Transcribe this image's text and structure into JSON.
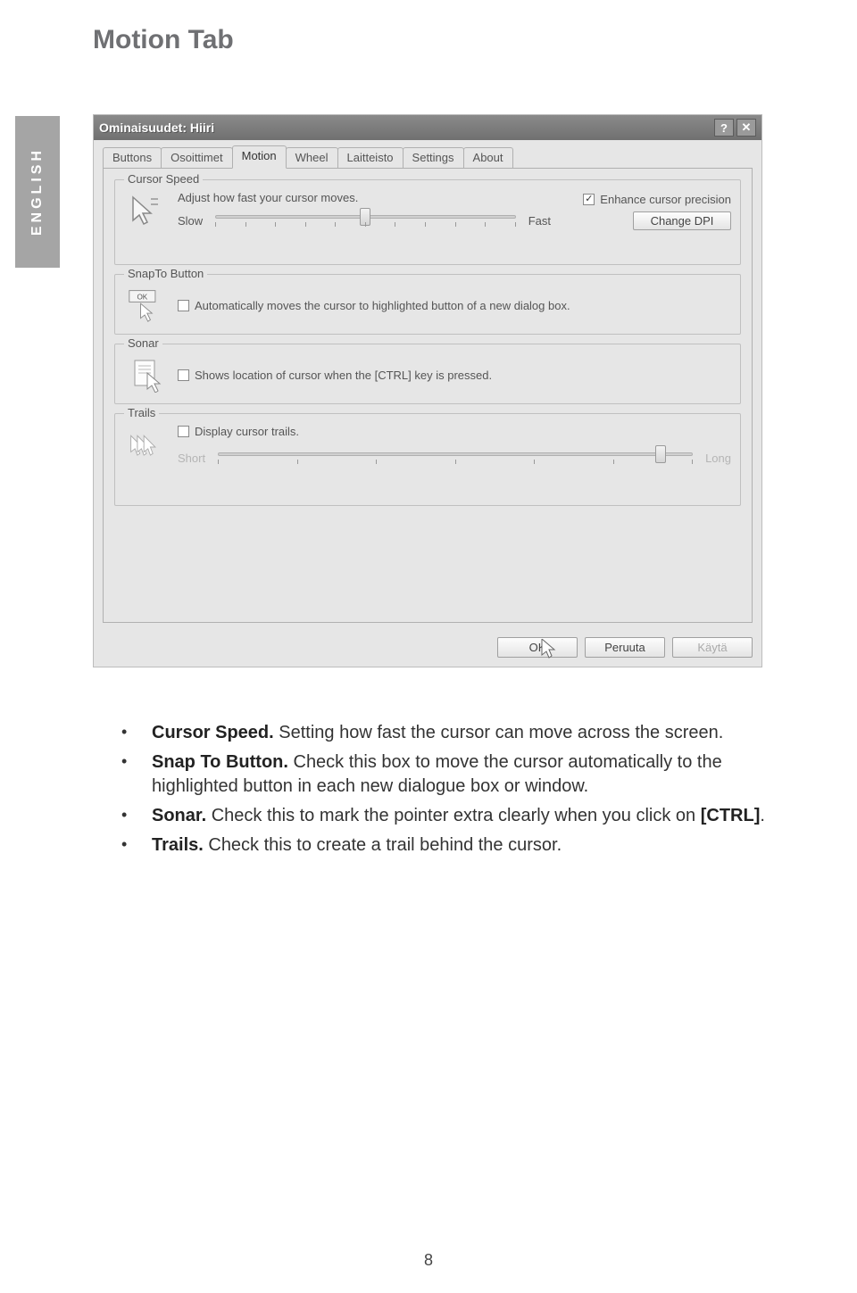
{
  "side_tab": "ENGLISH",
  "page_title": "Motion Tab",
  "dialog": {
    "title": "Ominaisuudet: Hiiri",
    "tabs": [
      "Buttons",
      "Osoittimet",
      "Motion",
      "Wheel",
      "Laitteisto",
      "Settings",
      "About"
    ],
    "active_tab_index": 2,
    "cursor_speed": {
      "group": "Cursor Speed",
      "desc": "Adjust how fast your cursor moves.",
      "slow": "Slow",
      "fast": "Fast",
      "enhance_label": "Enhance cursor precision",
      "enhance_checked": true,
      "change_dpi": "Change DPI",
      "slider_pos_pct": 48
    },
    "snapto": {
      "group": "SnapTo Button",
      "checked": false,
      "label": "Automatically moves the cursor to highlighted button of a new dialog box.",
      "icon_text": "OK"
    },
    "sonar": {
      "group": "Sonar",
      "checked": false,
      "label": "Shows location of cursor when the [CTRL] key is pressed."
    },
    "trails": {
      "group": "Trails",
      "checked": false,
      "label": "Display cursor trails.",
      "short": "Short",
      "long": "Long",
      "slider_pos_pct": 92
    },
    "footer": {
      "ok": "OK",
      "cancel": "Peruuta",
      "apply": "Käytä"
    }
  },
  "bullets": {
    "b1_bold": "Cursor Speed.",
    "b1_rest": " Setting how fast the cursor can move across the screen.",
    "b2_bold": "Snap To Button.",
    "b2_rest": " Check this box to move the cursor automatically to the highlighted button in each new dialogue box or window.",
    "b3_bold": "Sonar.",
    "b3_rest": " Check this to mark the pointer extra clearly when you click on ",
    "b3_bold2": "[CTRL]",
    "b3_rest2": ".",
    "b4_bold": "Trails.",
    "b4_rest": " Check this to create a trail behind the cursor."
  },
  "page_number": "8"
}
